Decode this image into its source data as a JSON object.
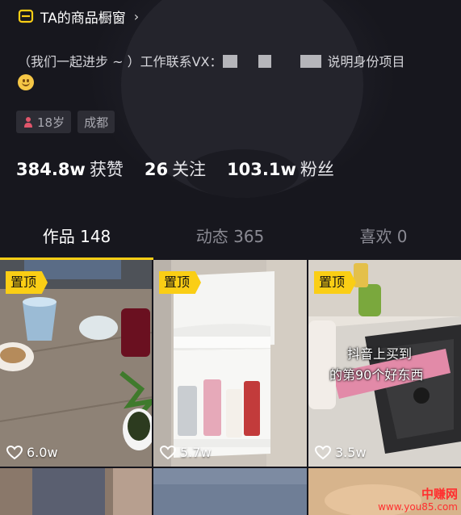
{
  "header": {
    "shop_label": "TA的商品橱窗",
    "bio_line1_start": "（我们一起进步 ~ ）工作联系VX：",
    "bio_line1_end": "说明身份项目",
    "tags": [
      {
        "label": "18岁",
        "icon": "female-icon"
      },
      {
        "label": "成都"
      }
    ]
  },
  "stats": [
    {
      "value": "384.8w",
      "label": "获赞"
    },
    {
      "value": "26",
      "label": "关注"
    },
    {
      "value": "103.1w",
      "label": "粉丝"
    }
  ],
  "tabs": [
    {
      "label": "作品 148",
      "active": true
    },
    {
      "label": "动态 365",
      "active": false
    },
    {
      "label": "喜欢 0",
      "active": false
    }
  ],
  "videos": [
    {
      "pin": "置顶",
      "likes": "6.0w"
    },
    {
      "pin": "置顶",
      "likes": "5.7w"
    },
    {
      "pin": "置顶",
      "likes": "3.5w",
      "caption_line1": "抖音上买到",
      "caption_line2": "的第90个好东西"
    }
  ],
  "watermark": {
    "line1": "中赚网",
    "line2": "www.you85.com"
  },
  "colors": {
    "accent": "#face15",
    "background": "#16161d"
  }
}
